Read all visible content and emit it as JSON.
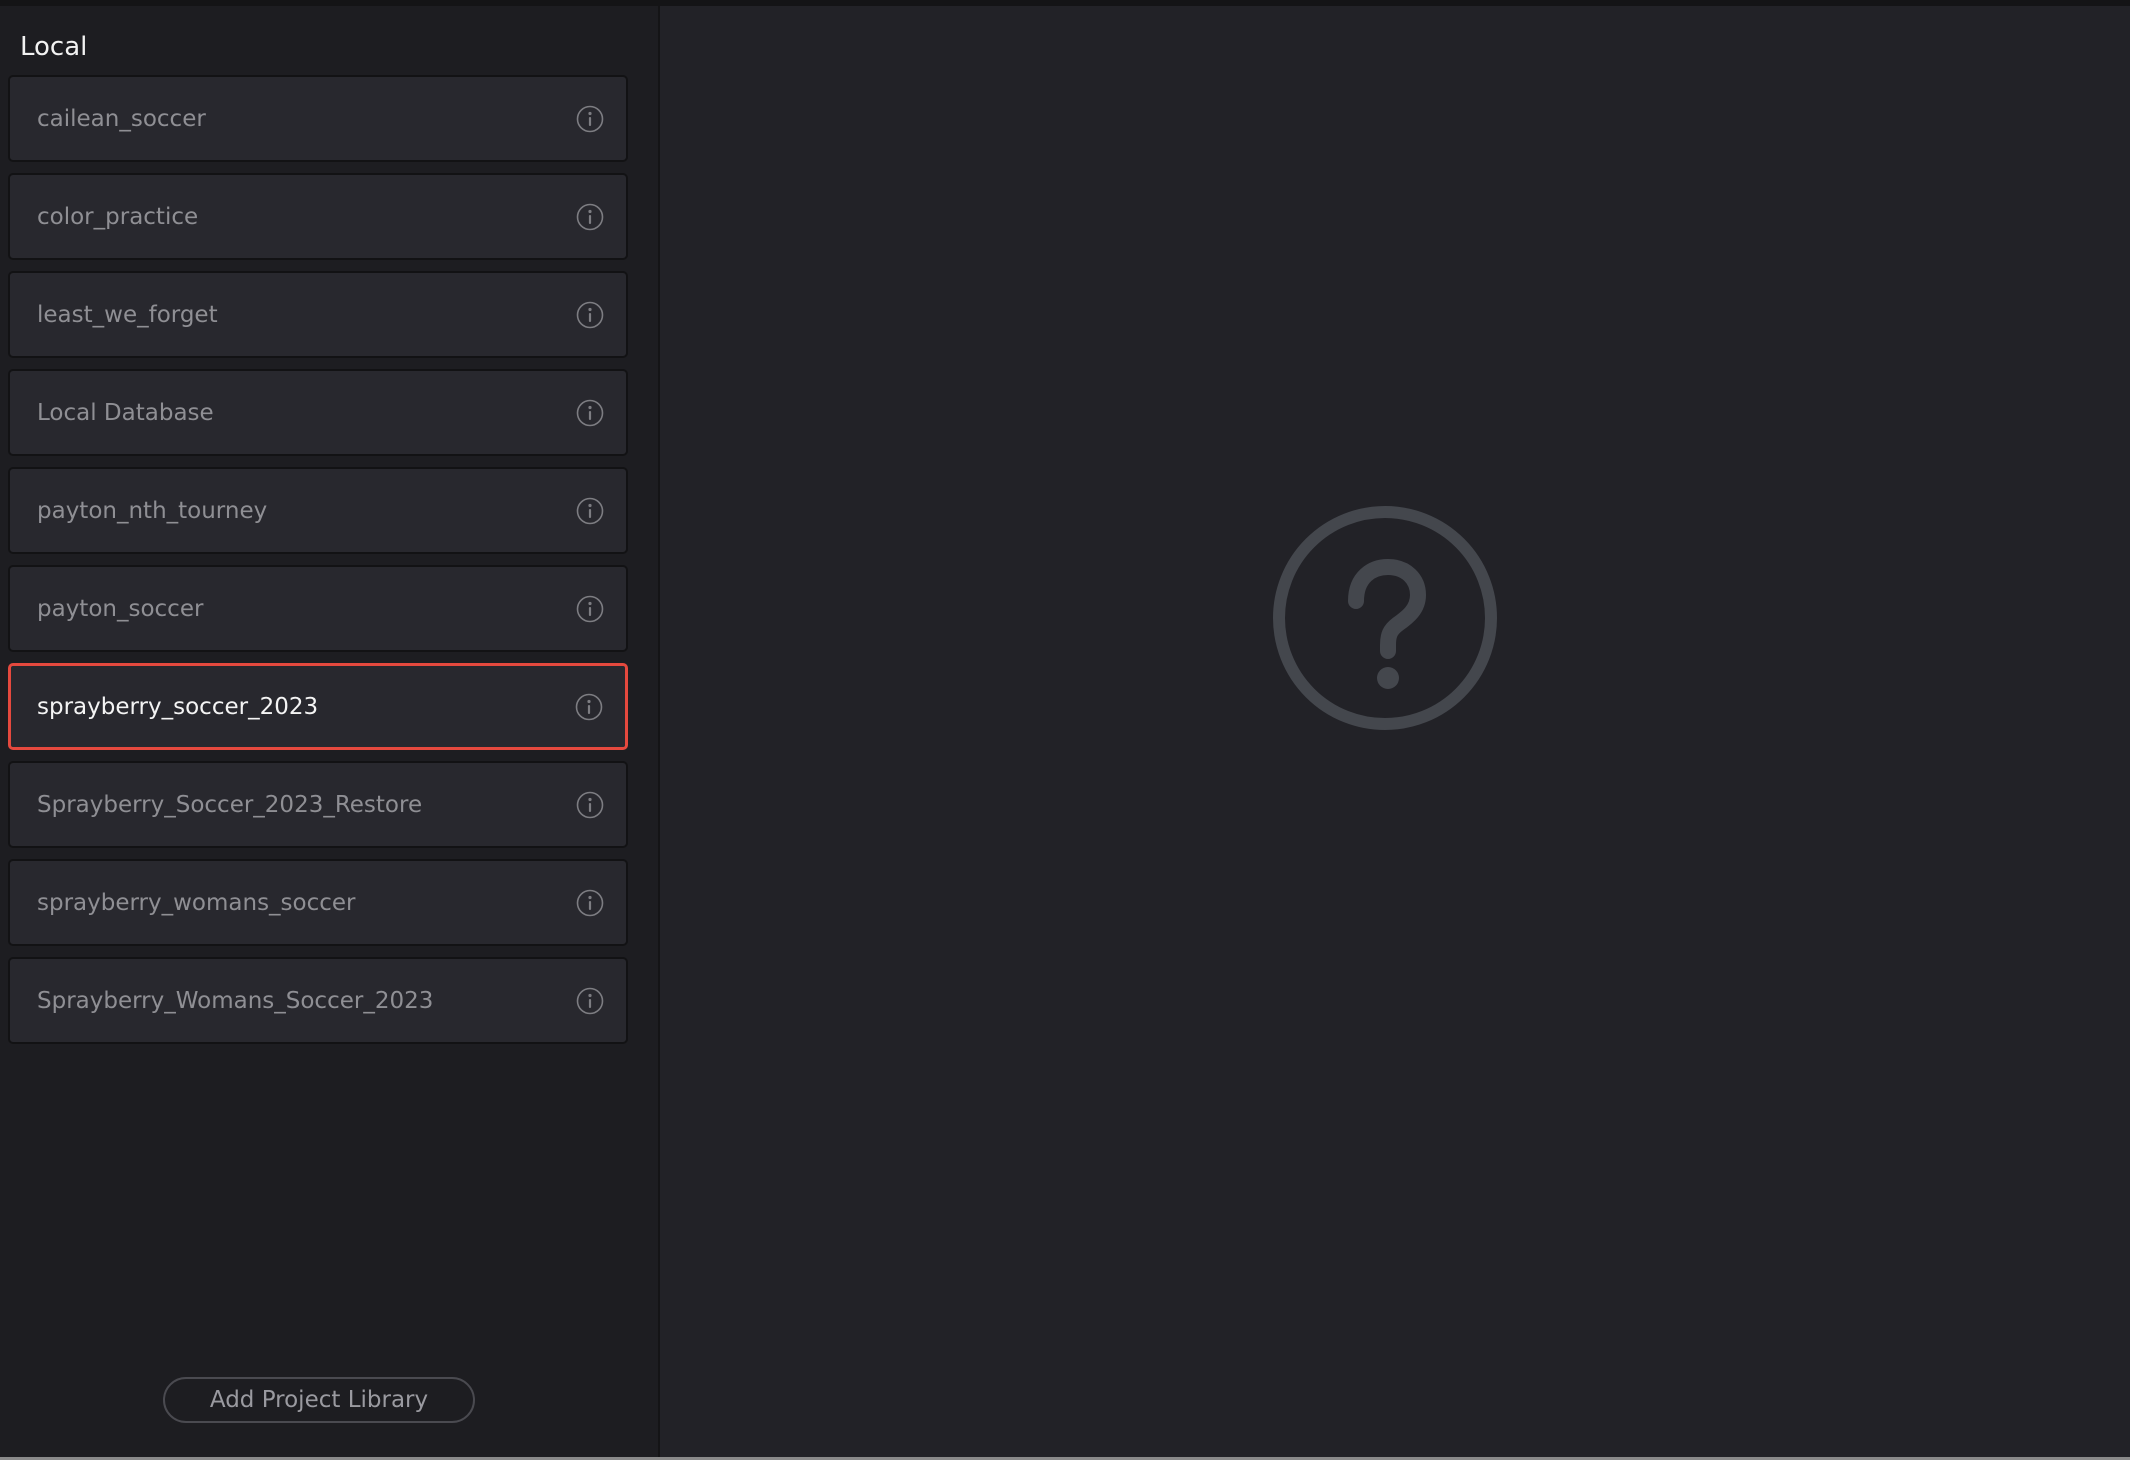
{
  "sidebar": {
    "title": "Local",
    "items": [
      {
        "label": "cailean_soccer",
        "selected": false
      },
      {
        "label": "color_practice",
        "selected": false
      },
      {
        "label": "least_we_forget",
        "selected": false
      },
      {
        "label": "Local Database",
        "selected": false
      },
      {
        "label": "payton_nth_tourney",
        "selected": false
      },
      {
        "label": "payton_soccer",
        "selected": false
      },
      {
        "label": "sprayberry_soccer_2023",
        "selected": true
      },
      {
        "label": "Sprayberry_Soccer_2023_Restore",
        "selected": false
      },
      {
        "label": "sprayberry_womans_soccer",
        "selected": false
      },
      {
        "label": "Sprayberry_Womans_Soccer_2023",
        "selected": false
      }
    ],
    "item_icon": "info-icon",
    "add_button_label": "Add Project Library"
  },
  "main": {
    "placeholder_icon": "question-circle-icon"
  },
  "colors": {
    "selection_border": "#e5493e",
    "background": "#222227",
    "sidebar_background": "#1d1d21",
    "placeholder_icon": "#44474d"
  }
}
